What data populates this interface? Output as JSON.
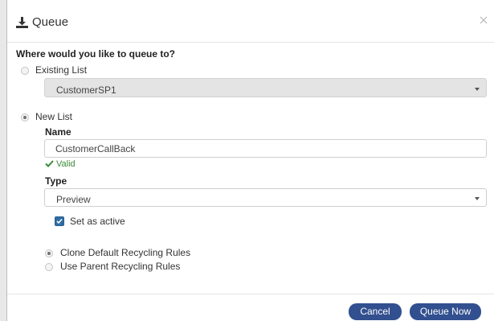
{
  "dialog": {
    "title": "Queue",
    "icon": "download-icon",
    "close_icon": "close-icon"
  },
  "question": "Where would you like to queue to?",
  "existing_list": {
    "label": "Existing List",
    "selected": false,
    "select_value": "CustomerSP1",
    "select_disabled": true
  },
  "new_list": {
    "label": "New List",
    "selected": true,
    "name_label": "Name",
    "name_value": "CustomerCallBack",
    "valid_text": "Valid",
    "type_label": "Type",
    "type_value": "Preview",
    "set_active_label": "Set as active",
    "set_active_checked": true
  },
  "recycling": {
    "clone_label": "Clone Default Recycling Rules",
    "clone_selected": true,
    "parent_label": "Use Parent Recycling Rules",
    "parent_selected": false
  },
  "footer": {
    "cancel_label": "Cancel",
    "queue_now_label": "Queue Now"
  },
  "colors": {
    "primary_button": "#32508f",
    "valid_green": "#3a8a3a",
    "checkbox_blue": "#2e6da4"
  }
}
